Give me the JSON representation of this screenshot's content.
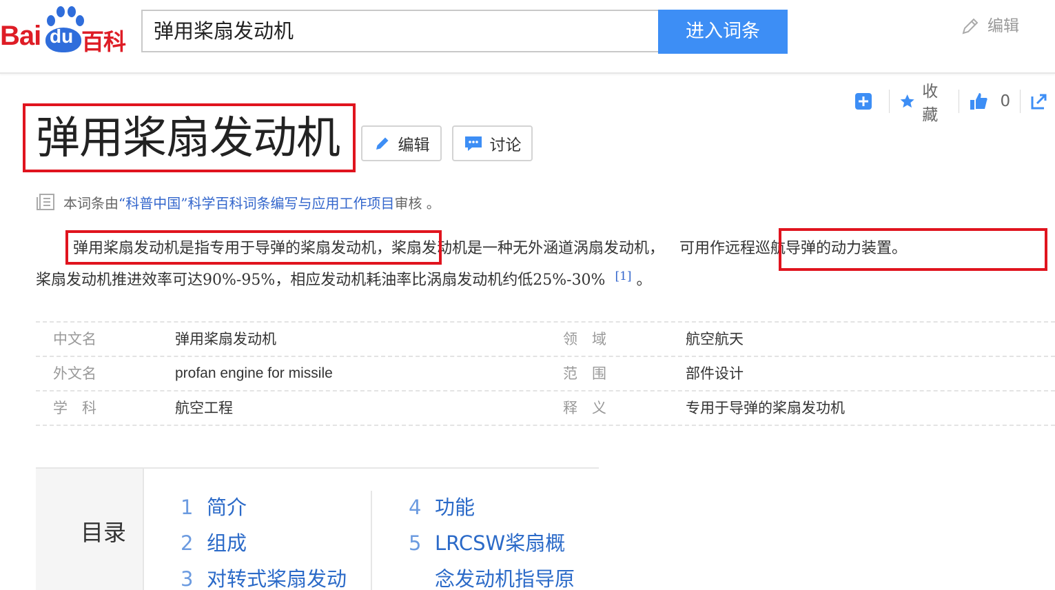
{
  "header": {
    "logo_bai": "Bai",
    "logo_du": "du",
    "logo_baike": "百科",
    "search_value": "弹用桨扇发动机",
    "search_button": "进入词条",
    "top_edit": "编辑"
  },
  "actions": {
    "favorite": "收藏",
    "like_count": "0"
  },
  "title": {
    "text": "弹用桨扇发动机",
    "edit": "编辑",
    "discuss": "讨论"
  },
  "review": {
    "prefix": "本词条由",
    "link": "“科普中国”科学百科词条编写与应用工作项目",
    "suffix": " 审核 。"
  },
  "summary": {
    "seg1": "弹用桨扇发动机是指专用于导弹的桨扇发动机，",
    "seg2": "桨扇发动机是一种无外涵道涡扇发动机，",
    "seg3": "可用作远程巡航导弹的动力装置。",
    "line2": "桨扇发动机推进效率可达90%-95%，相应发动机耗油率比涡扇发动机约低25%-30%",
    "ref": "[1]",
    "end": " 。"
  },
  "info": [
    {
      "label1": "中文名",
      "value1": "弹用桨扇发动机",
      "label2": "领　域",
      "value2": "航空航天"
    },
    {
      "label1": "外文名",
      "value1": "profan engine for missile",
      "label2": "范　围",
      "value2": "部件设计"
    },
    {
      "label1": "学　科",
      "value1": "航空工程",
      "label2": "释　义",
      "value2": "专用于导弹的桨扇发功机"
    }
  ],
  "toc": {
    "label": "目录",
    "items": [
      {
        "num": "1",
        "text": "简介"
      },
      {
        "num": "2",
        "text": "组成"
      },
      {
        "num": "3",
        "text": "对转式桨扇发动"
      },
      {
        "num": "4",
        "text": "功能"
      },
      {
        "num": "5",
        "text": "LRCSW桨扇概"
      },
      {
        "num": "",
        "text": "念发动机指导原"
      }
    ]
  },
  "colors": {
    "accent_blue": "#3d8ef5",
    "link_blue": "#3366cc",
    "highlight_red": "#e0141e",
    "brand_red": "#de1d26"
  }
}
